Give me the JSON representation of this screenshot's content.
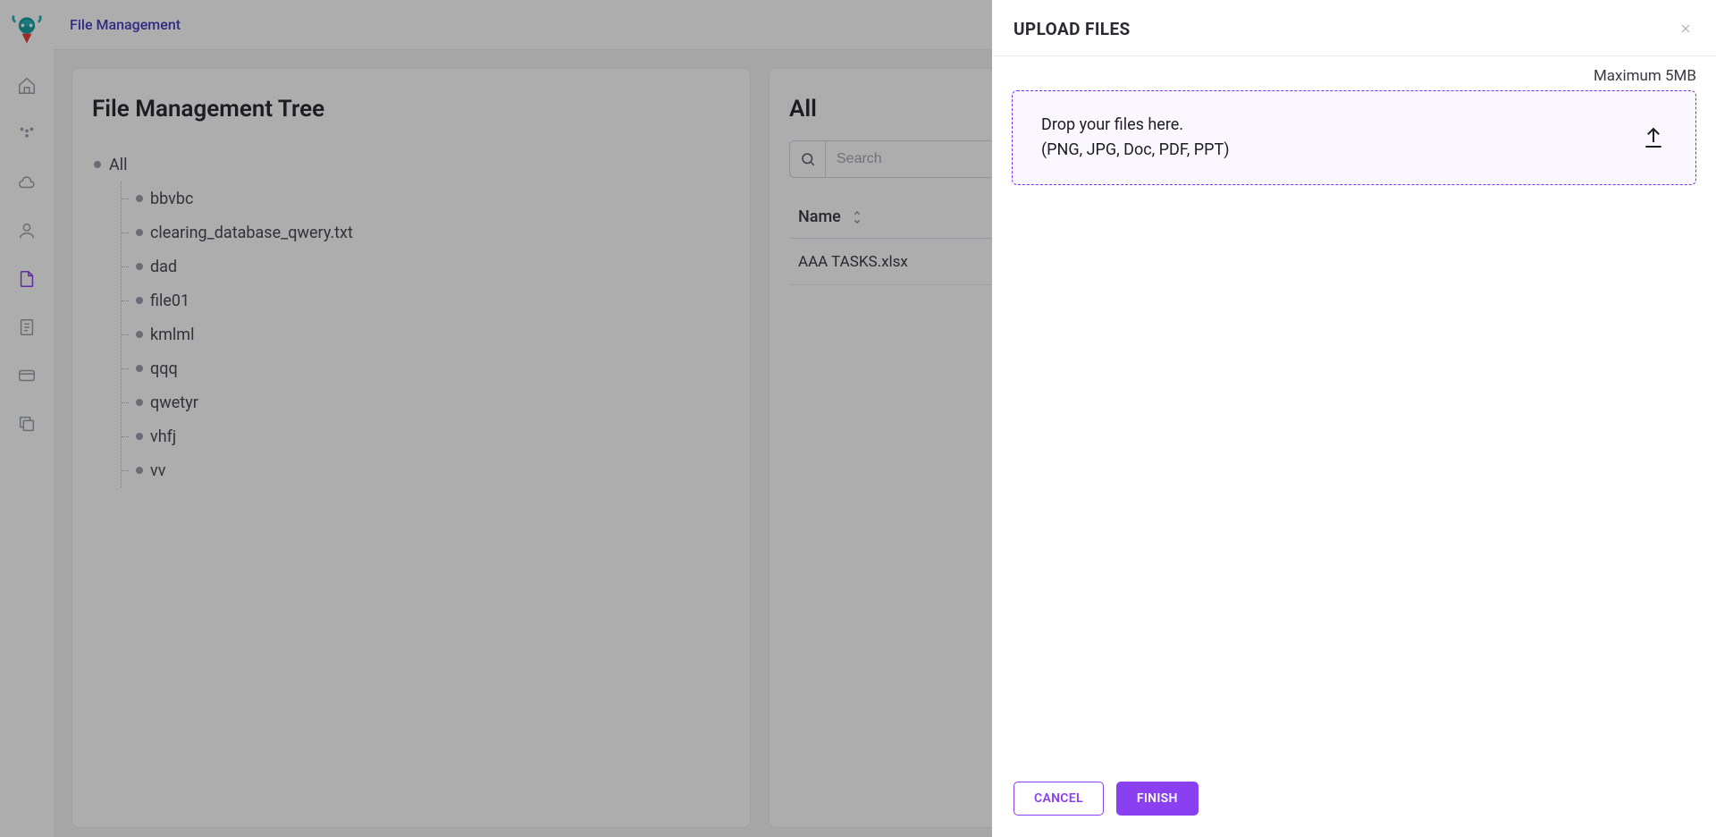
{
  "header": {
    "title": "File Management"
  },
  "sidebar": {
    "items": [
      {
        "name": "home-icon"
      },
      {
        "name": "apps-icon"
      },
      {
        "name": "cloud-icon"
      },
      {
        "name": "user-icon"
      },
      {
        "name": "file-icon",
        "active": true
      },
      {
        "name": "document-icon"
      },
      {
        "name": "card-icon"
      },
      {
        "name": "copy-icon"
      }
    ]
  },
  "treepanel": {
    "title": "File Management Tree",
    "root": "All",
    "items": [
      "bbvbc",
      "clearing_database_qwery.txt",
      "dad",
      "file01",
      "kmlml",
      "qqq",
      "qwetyr",
      "vhfj",
      "vv"
    ]
  },
  "listpanel": {
    "title": "All",
    "search_placeholder": "Search",
    "column_name": "Name",
    "rows": [
      "AAA TASKS.xlsx"
    ]
  },
  "drawer": {
    "title": "UPLOAD FILES",
    "max_label": "Maximum 5MB",
    "drop_line1": "Drop your files here.",
    "drop_line2": "(PNG, JPG, Doc, PDF, PPT)",
    "cancel": "CANCEL",
    "finish": "FINISH"
  }
}
